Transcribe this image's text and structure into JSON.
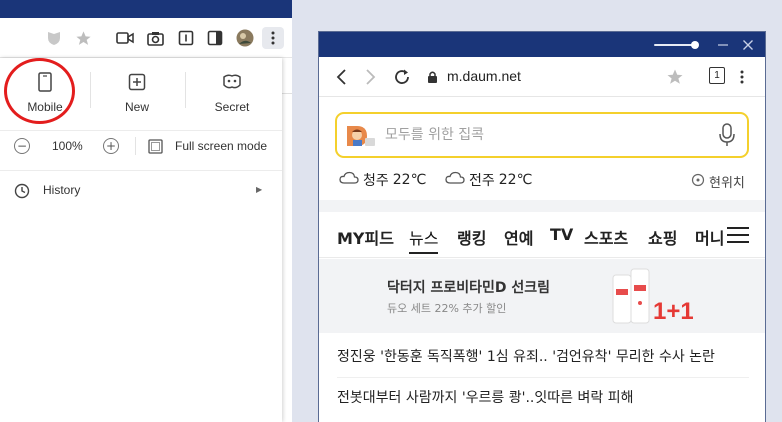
{
  "menu": {
    "tiles": [
      {
        "label": "Mobile",
        "icon": "phone-icon"
      },
      {
        "label": "New",
        "icon": "plus-square-icon"
      },
      {
        "label": "Secret",
        "icon": "mask-icon"
      }
    ],
    "zoom": {
      "decrease": "−",
      "increase": "+",
      "level": "100%"
    },
    "fullscreen_label": "Full screen mode",
    "history_label": "History",
    "highlight_color": "#e31d1d"
  },
  "mobile": {
    "url": "m.daum.net",
    "tab_count": "1",
    "search": {
      "placeholder": "모두를 위한 집콕"
    },
    "weather": [
      {
        "city": "청주",
        "temp": "22℃"
      },
      {
        "city": "전주",
        "temp": "22℃"
      }
    ],
    "location_label": "현위치",
    "tabs": [
      "MY피드",
      "뉴스",
      "랭킹",
      "연예",
      "TV",
      "스포츠",
      "쇼핑",
      "머니"
    ],
    "active_tab": "뉴스",
    "ad": {
      "title": "닥터지 프로비타민D 선크림",
      "subtitle": "듀오 세트 22% 추가 할인",
      "badge": "1+1"
    },
    "news": [
      "정진웅 '한동훈 독직폭행' 1심 유죄.. '검언유착' 무리한 수사 논란",
      "전봇대부터 사람까지 '우르릉 쾅'..잇따른 벼락 피해"
    ]
  },
  "colors": {
    "titlebar": "#1a3579",
    "search_border": "#f4d02c",
    "background": "#dfe3ee"
  }
}
